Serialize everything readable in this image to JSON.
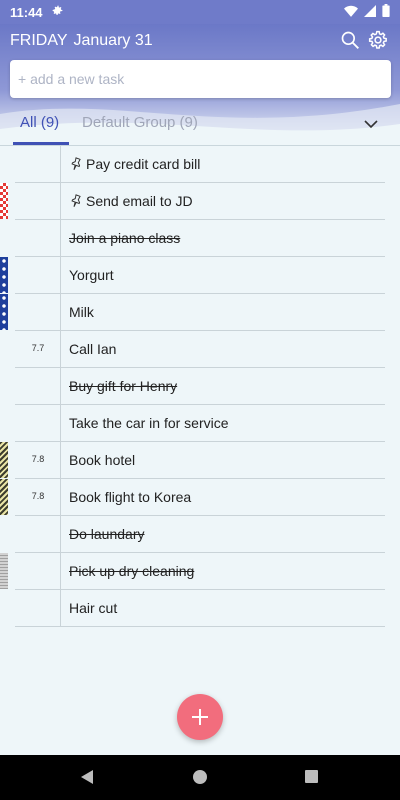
{
  "status_bar": {
    "time": "11:44",
    "icons": [
      "settings-icon",
      "wifi-icon",
      "signal-icon",
      "battery-icon"
    ]
  },
  "header": {
    "day": "FRIDAY",
    "date": "January 31",
    "add_placeholder": "+ add a new task",
    "icons": [
      "search-icon",
      "gear-icon"
    ]
  },
  "tabs": {
    "all": "All (9)",
    "group": "Default Group (9)"
  },
  "tasks": [
    {
      "text": "Pay credit card bill",
      "pinned": true,
      "done": false,
      "num": "",
      "marker": ""
    },
    {
      "text": "Send email to JD",
      "pinned": true,
      "done": false,
      "num": "",
      "marker": "red-checker"
    },
    {
      "text": "Join a piano class",
      "pinned": false,
      "done": true,
      "num": "",
      "marker": ""
    },
    {
      "text": "Yorgurt",
      "pinned": false,
      "done": false,
      "num": "",
      "marker": "blue-diamond"
    },
    {
      "text": "Milk",
      "pinned": false,
      "done": false,
      "num": "",
      "marker": "blue-diamond"
    },
    {
      "text": "Call Ian",
      "pinned": false,
      "done": false,
      "num": "7.7",
      "marker": ""
    },
    {
      "text": "Buy gift for Henry",
      "pinned": false,
      "done": true,
      "num": "",
      "marker": ""
    },
    {
      "text": "Take the car in for service",
      "pinned": false,
      "done": false,
      "num": "",
      "marker": ""
    },
    {
      "text": "Book hotel",
      "pinned": false,
      "done": false,
      "num": "7.8",
      "marker": "yellow-stripe"
    },
    {
      "text": "Book flight to Korea",
      "pinned": false,
      "done": false,
      "num": "7.8",
      "marker": "yellow-stripe"
    },
    {
      "text": "Do laundary",
      "pinned": false,
      "done": true,
      "num": "",
      "marker": ""
    },
    {
      "text": "Pick up dry cleaning",
      "pinned": false,
      "done": true,
      "num": "",
      "marker": "gray-grid"
    },
    {
      "text": "Hair cut",
      "pinned": false,
      "done": false,
      "num": "",
      "marker": ""
    }
  ],
  "fab": {
    "icon": "plus-icon"
  },
  "colors": {
    "header": "#6b78c7",
    "accent": "#3f51b5",
    "fab": "#f26d7d",
    "background": "#eef6f9"
  }
}
